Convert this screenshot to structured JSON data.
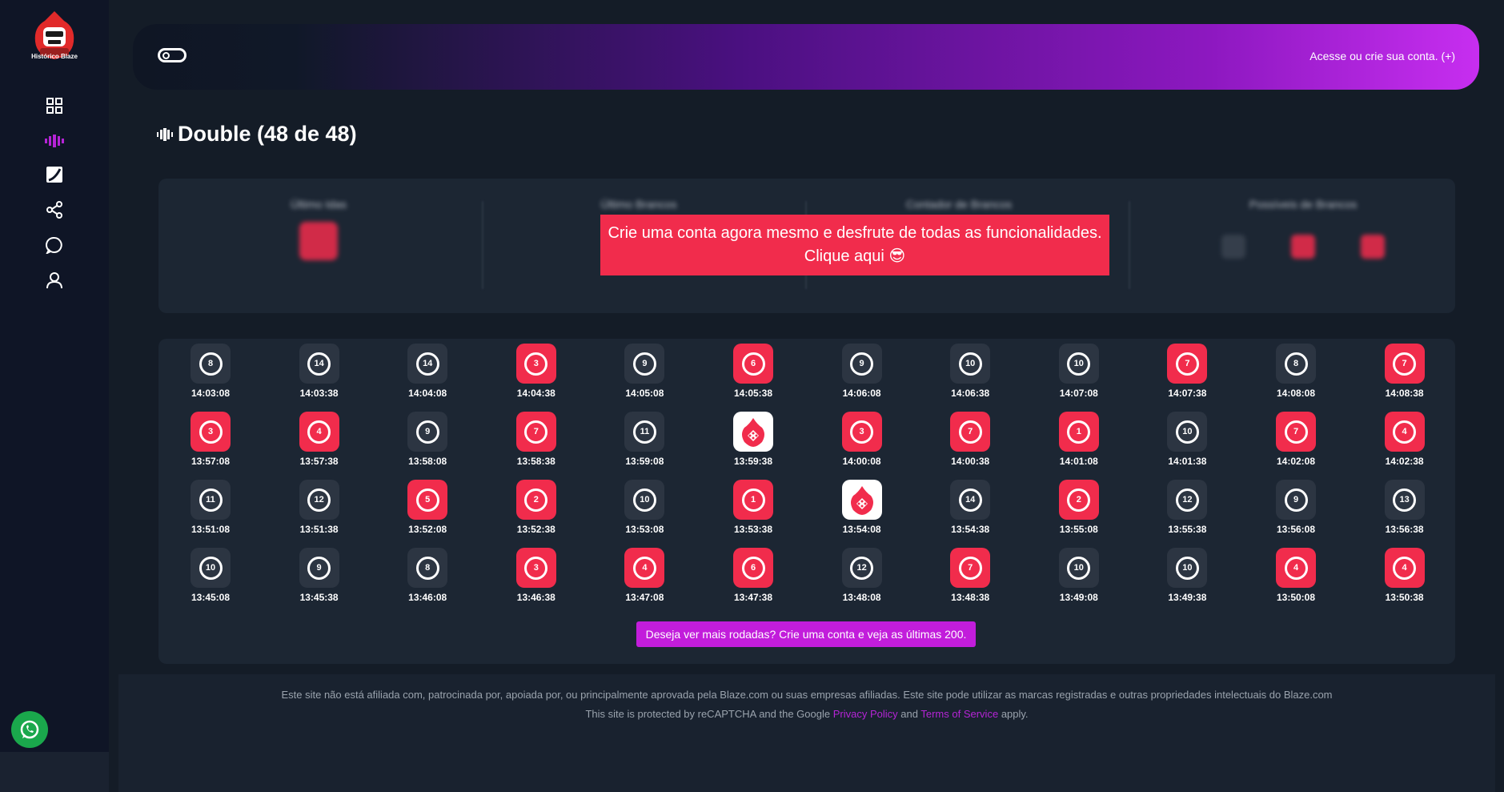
{
  "brand": {
    "logo_text": "Histórico Blaze",
    "accent": "#c21ddb",
    "red": "#f12c4c"
  },
  "sidebar": {
    "items": [
      {
        "icon": "grid-icon",
        "label": ""
      },
      {
        "icon": "double-icon",
        "label": ""
      },
      {
        "icon": "crash-icon",
        "label": ""
      },
      {
        "icon": "share-icon",
        "label": ""
      },
      {
        "icon": "chat-icon",
        "label": ""
      },
      {
        "icon": "user-icon",
        "label": ""
      }
    ]
  },
  "header": {
    "login_link": "Acesse ou crie sua conta. (+)"
  },
  "page": {
    "title": "Double (48 de 48)"
  },
  "stats": {
    "labels": [
      "Último Idas",
      "Último Brancos",
      "Contador de Brancos",
      "Possíveis de Brancos"
    ],
    "promo_line1": "Crie uma conta agora mesmo e desfrute de todas as funcionalidades.",
    "promo_line2": "Clique aqui 😎"
  },
  "rolls": [
    [
      {
        "n": "8",
        "c": "black",
        "t": "14:03:08"
      },
      {
        "n": "14",
        "c": "black",
        "t": "14:03:38"
      },
      {
        "n": "14",
        "c": "black",
        "t": "14:04:08"
      },
      {
        "n": "3",
        "c": "red",
        "t": "14:04:38"
      },
      {
        "n": "9",
        "c": "black",
        "t": "14:05:08"
      },
      {
        "n": "6",
        "c": "red",
        "t": "14:05:38"
      },
      {
        "n": "9",
        "c": "black",
        "t": "14:06:08"
      },
      {
        "n": "10",
        "c": "black",
        "t": "14:06:38"
      },
      {
        "n": "10",
        "c": "black",
        "t": "14:07:08"
      },
      {
        "n": "7",
        "c": "red",
        "t": "14:07:38"
      },
      {
        "n": "8",
        "c": "black",
        "t": "14:08:08"
      },
      {
        "n": "7",
        "c": "red",
        "t": "14:08:38"
      }
    ],
    [
      {
        "n": "3",
        "c": "red",
        "t": "13:57:08"
      },
      {
        "n": "4",
        "c": "red",
        "t": "13:57:38"
      },
      {
        "n": "9",
        "c": "black",
        "t": "13:58:08"
      },
      {
        "n": "7",
        "c": "red",
        "t": "13:58:38"
      },
      {
        "n": "11",
        "c": "black",
        "t": "13:59:08"
      },
      {
        "n": "",
        "c": "white",
        "t": "13:59:38"
      },
      {
        "n": "3",
        "c": "red",
        "t": "14:00:08"
      },
      {
        "n": "7",
        "c": "red",
        "t": "14:00:38"
      },
      {
        "n": "1",
        "c": "red",
        "t": "14:01:08"
      },
      {
        "n": "10",
        "c": "black",
        "t": "14:01:38"
      },
      {
        "n": "7",
        "c": "red",
        "t": "14:02:08"
      },
      {
        "n": "4",
        "c": "red",
        "t": "14:02:38"
      }
    ],
    [
      {
        "n": "11",
        "c": "black",
        "t": "13:51:08"
      },
      {
        "n": "12",
        "c": "black",
        "t": "13:51:38"
      },
      {
        "n": "5",
        "c": "red",
        "t": "13:52:08"
      },
      {
        "n": "2",
        "c": "red",
        "t": "13:52:38"
      },
      {
        "n": "10",
        "c": "black",
        "t": "13:53:08"
      },
      {
        "n": "1",
        "c": "red",
        "t": "13:53:38"
      },
      {
        "n": "",
        "c": "white",
        "t": "13:54:08"
      },
      {
        "n": "14",
        "c": "black",
        "t": "13:54:38"
      },
      {
        "n": "2",
        "c": "red",
        "t": "13:55:08"
      },
      {
        "n": "12",
        "c": "black",
        "t": "13:55:38"
      },
      {
        "n": "9",
        "c": "black",
        "t": "13:56:08"
      },
      {
        "n": "13",
        "c": "black",
        "t": "13:56:38"
      }
    ],
    [
      {
        "n": "10",
        "c": "black",
        "t": "13:45:08"
      },
      {
        "n": "9",
        "c": "black",
        "t": "13:45:38"
      },
      {
        "n": "8",
        "c": "black",
        "t": "13:46:08"
      },
      {
        "n": "3",
        "c": "red",
        "t": "13:46:38"
      },
      {
        "n": "4",
        "c": "red",
        "t": "13:47:08"
      },
      {
        "n": "6",
        "c": "red",
        "t": "13:47:38"
      },
      {
        "n": "12",
        "c": "black",
        "t": "13:48:08"
      },
      {
        "n": "7",
        "c": "red",
        "t": "13:48:38"
      },
      {
        "n": "10",
        "c": "black",
        "t": "13:49:08"
      },
      {
        "n": "10",
        "c": "black",
        "t": "13:49:38"
      },
      {
        "n": "4",
        "c": "red",
        "t": "13:50:08"
      },
      {
        "n": "4",
        "c": "red",
        "t": "13:50:38"
      }
    ]
  ],
  "more_button": "Deseja ver mais rodadas? Crie uma conta e veja as últimas 200.",
  "footer": {
    "disclaimer": "Este site não está afiliada com, patrocinada por, apoiada por, ou principalmente aprovada pela Blaze.com ou suas empresas afiliadas. Este site pode utilizar as marcas registradas e outras propriedades intelectuais do Blaze.com",
    "recaptcha_prefix": "This site is protected by reCAPTCHA and the Google",
    "privacy_link": "Privacy Policy",
    "and_text": "and",
    "terms_link": "Terms of Service",
    "recaptcha_suffix": "apply."
  }
}
